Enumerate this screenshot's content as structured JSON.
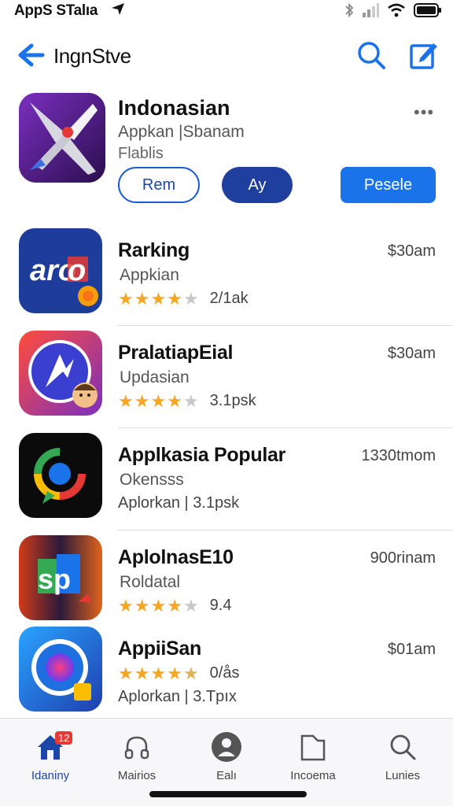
{
  "status_bar": {
    "carrier": "AppS STalıa",
    "icons": [
      "location-arrow-icon",
      "bluetooth-icon",
      "signal-icon",
      "wifi-icon",
      "battery-icon"
    ]
  },
  "nav": {
    "title": "IngnStve",
    "icons": [
      "back-chevron-icon",
      "search-icon",
      "compose-icon"
    ],
    "accent": "#1a73e8"
  },
  "featured": {
    "title": "Indonasian",
    "subtitle": "Appkan |Sbanam",
    "category": "Flablis",
    "more": "•••",
    "buttons": {
      "rem": "Rem",
      "ay": "Ay",
      "pesele": "Pesele"
    }
  },
  "apps": [
    {
      "name": "Rarking",
      "sub": "Appkian",
      "rating": 4,
      "reviews": "2/1ak",
      "price": "$30am",
      "icon": "aro-logo-icon"
    },
    {
      "name": "PralatiapEial",
      "sub": "Updasian",
      "rating": 4,
      "reviews": "3.1psk",
      "price": "$30am",
      "icon": "compass-a-icon"
    },
    {
      "name": "Applkasia Popular",
      "sub": "Okensss",
      "meta": "Aplorkan |   3.1psk",
      "price": "1330tmom",
      "icon": "map-pin-ring-icon"
    },
    {
      "name": "AplolnasE10",
      "sub": "Roldatal",
      "rating": 4,
      "reviews": "9.4",
      "price": "900rinam",
      "icon": "sd-logo-icon"
    },
    {
      "name": "AppiiSan",
      "sub": "",
      "rating": 4.5,
      "reviews": "0/ås",
      "meta": "Aplorkan |   3.Tpıx",
      "price": "$01am",
      "icon": "camera-circle-icon"
    }
  ],
  "tabs": [
    {
      "label": "Idaniny",
      "icon": "home-icon",
      "badge": "12"
    },
    {
      "label": "Mairios",
      "icon": "headphones-icon"
    },
    {
      "label": "Ealı",
      "icon": "person-circle-icon"
    },
    {
      "label": "Incoema",
      "icon": "folder-icon"
    },
    {
      "label": "Lunies",
      "icon": "search-icon"
    }
  ]
}
